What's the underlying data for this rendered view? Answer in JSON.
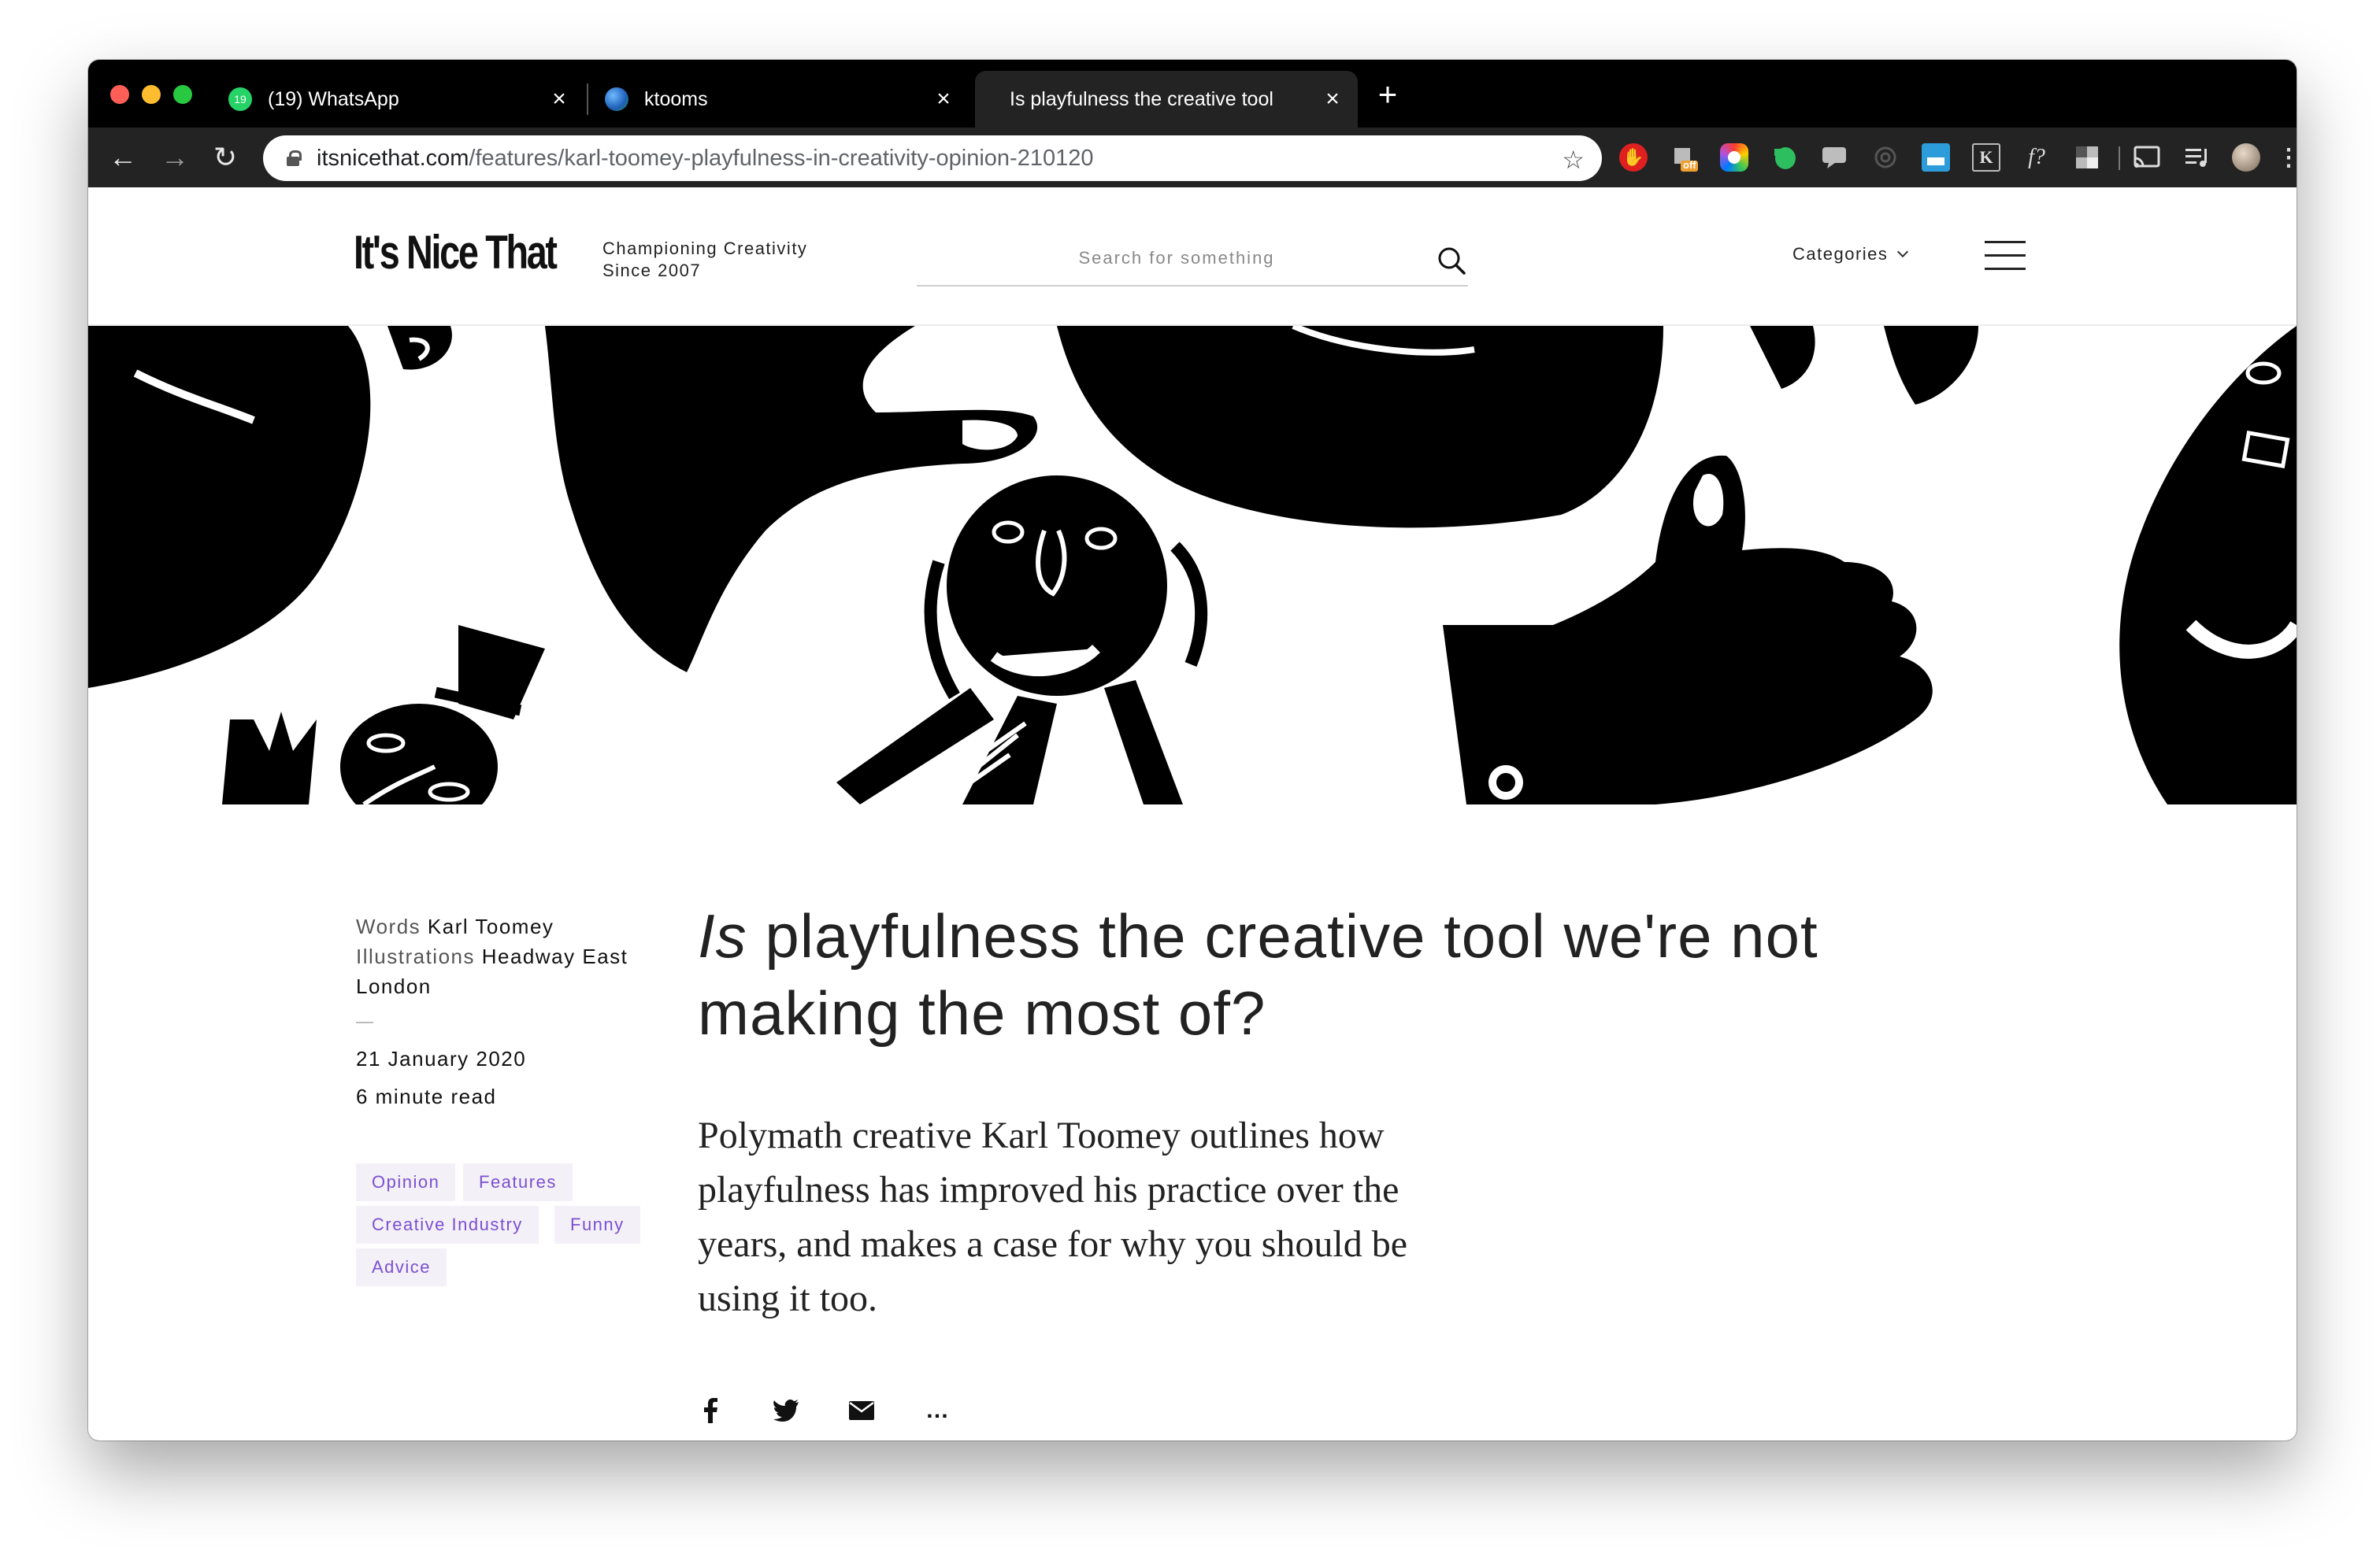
{
  "browser": {
    "tabs": [
      {
        "title": "(19) WhatsApp",
        "badge": "19",
        "favicon": "whatsapp-icon"
      },
      {
        "title": "ktooms",
        "favicon": "globe-icon"
      },
      {
        "title": "Is playfulness the creative tool",
        "favicon": "none"
      }
    ],
    "url_host": "itsnicethat.com",
    "url_path": "/features/karl-toomey-playfulness-in-creativity-opinion-210120",
    "extension_badge": "off"
  },
  "site": {
    "logo": "It's Nice That",
    "tagline_line1": "Championing Creativity",
    "tagline_line2": "Since 2007",
    "search_placeholder": "Search for something",
    "categories_label": "Categories"
  },
  "article": {
    "words_label": "Words",
    "author": "Karl Toomey",
    "illustrations_label": "Illustrations",
    "illustrator": "Headway East London",
    "date": "21 January 2020",
    "read_time": "6 minute read",
    "tags": [
      "Opinion",
      "Features",
      "Creative Industry",
      "Funny",
      "Advice"
    ],
    "headline_first_word": "Is",
    "headline_rest": " playfulness the creative tool we're not making the most of?",
    "standfirst": "Polymath creative Karl Toomey outlines how playfulness has improved his practice over the years, and makes a case for why you should be using it too.",
    "share": [
      "facebook-icon",
      "twitter-icon",
      "email-icon",
      "more-icon"
    ],
    "more_glyph": "…"
  },
  "colors": {
    "tag_text": "#7b4fd1",
    "tag_bg": "#f3f0f7",
    "browser_frame": "#000000",
    "toolbar": "#232323"
  }
}
